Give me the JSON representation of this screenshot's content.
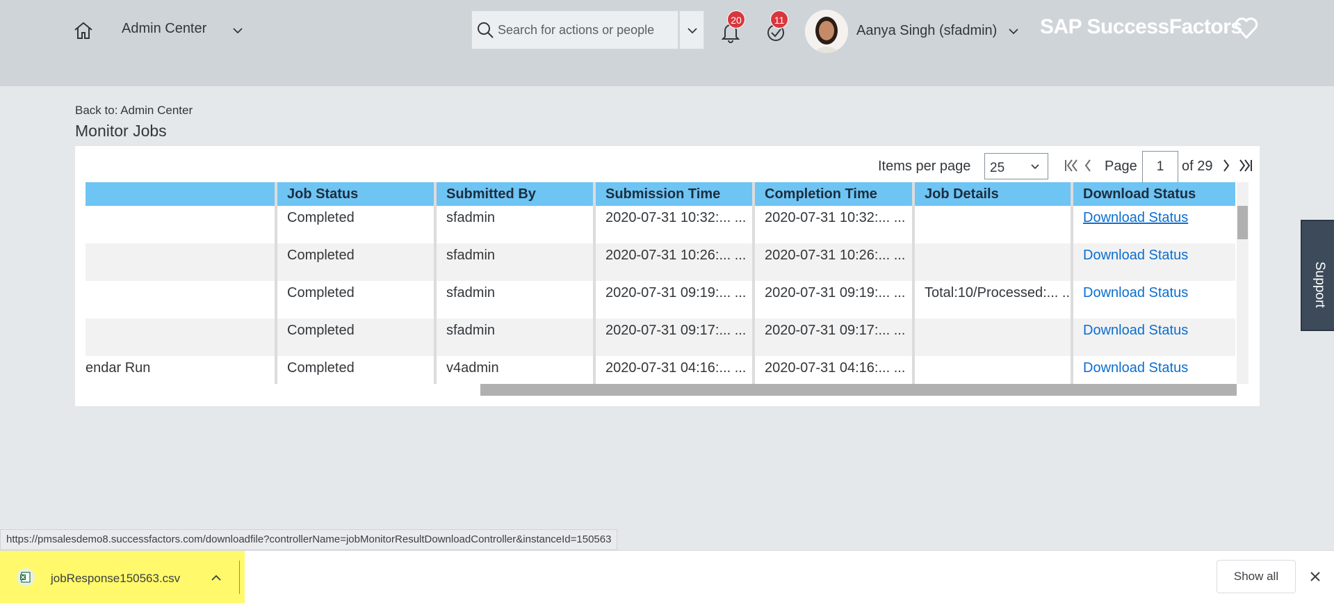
{
  "header": {
    "app_title": "Admin Center",
    "search_placeholder": "Search for actions or people",
    "notifications_count": "20",
    "todo_count": "11",
    "user_name": "Aanya Singh (sfadmin)",
    "brand": "SAP SuccessFactors"
  },
  "page": {
    "back_link": "Back to: Admin Center",
    "title": "Monitor Jobs"
  },
  "pagination": {
    "items_per_page_label": "Items per page",
    "items_per_page_value": "25",
    "page_label": "Page",
    "current_page": "1",
    "of_label": "of 29"
  },
  "table": {
    "headers": [
      "",
      "Job Status",
      "Submitted By",
      "Submission Time",
      "Completion Time",
      "Job Details",
      "Download Status"
    ],
    "rows": [
      {
        "name": "",
        "status": "Completed",
        "submitted_by": "sfadmin",
        "submission": "2020-07-31 10:32:... ...",
        "completion": "2020-07-31 10:32:... ...",
        "details": "",
        "download": "Download Status"
      },
      {
        "name": "",
        "status": "Completed",
        "submitted_by": "sfadmin",
        "submission": "2020-07-31 10:26:... ...",
        "completion": "2020-07-31 10:26:... ...",
        "details": "",
        "download": "Download Status"
      },
      {
        "name": "",
        "status": "Completed",
        "submitted_by": "sfadmin",
        "submission": "2020-07-31 09:19:... ...",
        "completion": "2020-07-31 09:19:... ...",
        "details": "Total:10/Processed:... ...",
        "download": "Download Status"
      },
      {
        "name": "",
        "status": "Completed",
        "submitted_by": "sfadmin",
        "submission": "2020-07-31 09:17:... ...",
        "completion": "2020-07-31 09:17:... ...",
        "details": "",
        "download": "Download Status"
      },
      {
        "name": "endar Run",
        "status": "Completed",
        "submitted_by": "v4admin",
        "submission": "2020-07-31 04:16:... ...",
        "completion": "2020-07-31 04:16:... ...",
        "details": "",
        "download": "Download Status"
      }
    ]
  },
  "support_label": "Support",
  "status_url": "https://pmsalesdemo8.successfactors.com/downloadfile?controllerName=jobMonitorResultDownloadController&instanceId=150563",
  "download_bar": {
    "file_name": "jobResponse150563.csv",
    "show_all": "Show all"
  },
  "colors": {
    "header_bg": "#cfd4d9",
    "table_header": "#6ec4f3",
    "link": "#0a6ed1",
    "badge": "#d9363e",
    "download_highlight": "#fff96b"
  }
}
